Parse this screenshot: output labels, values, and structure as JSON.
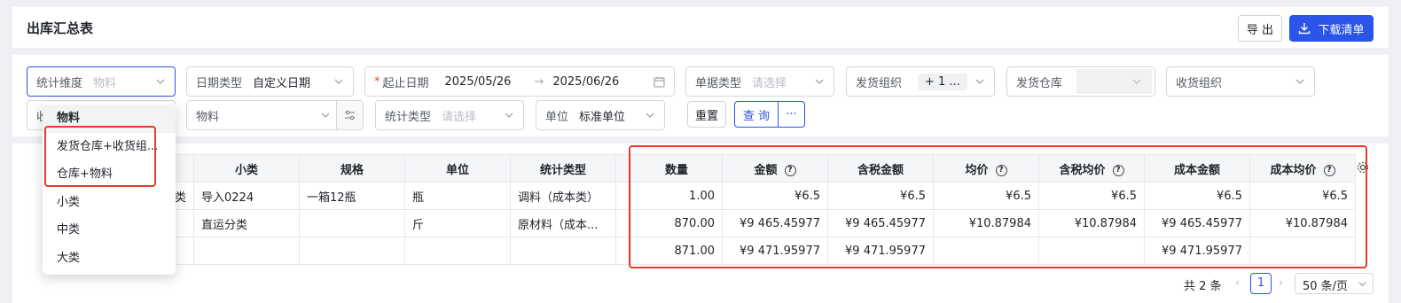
{
  "header": {
    "title": "出库汇总表",
    "export_label": "导 出",
    "download_label": "下载清单"
  },
  "filters": {
    "dimension": {
      "label": "统计维度",
      "value": "物料"
    },
    "date_type": {
      "label": "日期类型",
      "value": "自定义日期"
    },
    "date_range": {
      "label": "起止日期",
      "start": "2025/05/26",
      "end": "2025/06/26",
      "separator": "→"
    },
    "doc_type": {
      "label": "单据类型",
      "placeholder": "请选择"
    },
    "ship_org": {
      "label": "发货组织",
      "value": "+ 1 ..."
    },
    "ship_wh": {
      "label": "发货仓库"
    },
    "recv_org": {
      "label": "收货组织"
    },
    "recv_partial": "收",
    "material": {
      "placeholder": "物料"
    },
    "stat_type": {
      "label": "统计类型",
      "placeholder": "请选择"
    },
    "unit": {
      "label": "单位",
      "value": "标准单位"
    },
    "reset_label": "重置",
    "query_label": "查 询",
    "more_label": "···"
  },
  "dimension_options": [
    "物料",
    "发货仓库+收货组...",
    "仓库+物料",
    "小类",
    "中类",
    "大类"
  ],
  "table": {
    "columns": [
      "",
      "小类",
      "规格",
      "单位",
      "统计类型",
      "",
      "数量",
      "金额",
      "含税金额",
      "均价",
      "含税均价",
      "成本金额",
      "成本均价"
    ],
    "help_columns": [
      7,
      9,
      10,
      12
    ],
    "rows": [
      [
        "类",
        "导入0224",
        "一箱12瓶",
        "瓶",
        "调料（成本类）",
        "",
        "1.00",
        "¥6.5",
        "¥6.5",
        "¥6.5",
        "¥6.5",
        "¥6.5",
        "¥6.5"
      ],
      [
        "",
        "直运分类",
        "",
        "斤",
        "原材料（成本...",
        "",
        "870.00",
        "¥9 465.45977",
        "¥9 465.45977",
        "¥10.87984",
        "¥10.87984",
        "¥9 465.45977",
        "¥10.87984"
      ],
      [
        "",
        "",
        "",
        "",
        "",
        "",
        "871.00",
        "¥9 471.95977",
        "¥9 471.95977",
        "",
        "",
        "¥9 471.95977",
        ""
      ]
    ]
  },
  "pagination": {
    "total": "共 2 条",
    "current": "1",
    "page_size": "50 条/页"
  },
  "colors": {
    "primary": "#2b54e8",
    "highlight": "#e63b2e"
  }
}
